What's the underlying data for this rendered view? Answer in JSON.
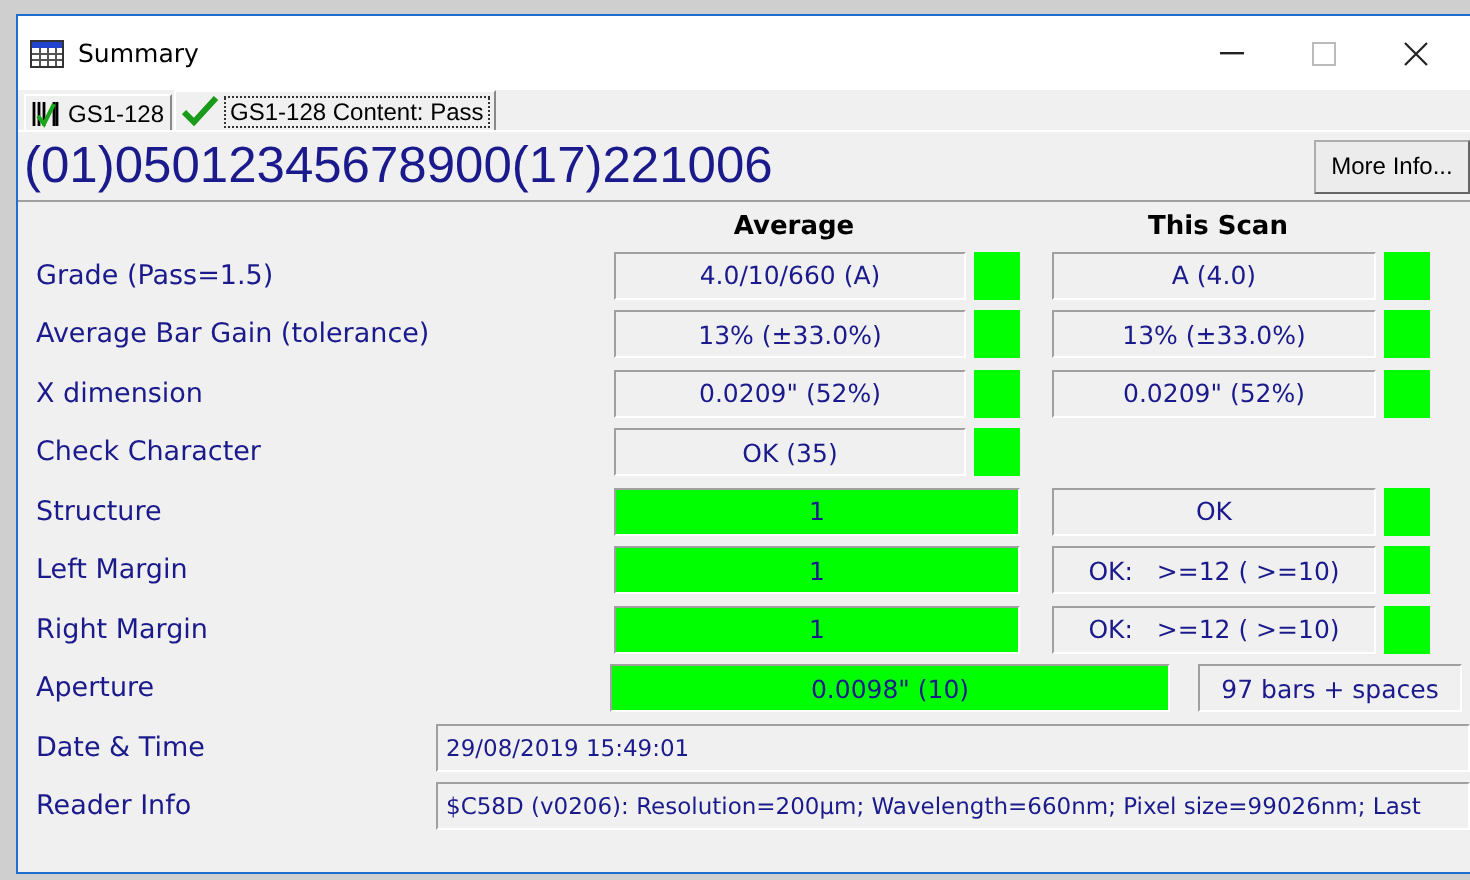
{
  "window": {
    "title": "Summary"
  },
  "tabs": [
    {
      "label": "GS1-128",
      "kind": "barcode",
      "selected": false
    },
    {
      "label": "GS1-128 Content: Pass",
      "kind": "check",
      "selected": true
    }
  ],
  "barcode_data": "(01)05012345678900(17)221006",
  "more_info_button": "More Info...",
  "columns": [
    "Average",
    "This Scan"
  ],
  "rows": [
    {
      "kind": "graded",
      "label": "Grade (Pass=1.5)",
      "average": {
        "text": "4.0/10/660 (A)",
        "pass": true
      },
      "scan": {
        "text": "A (4.0)",
        "pass": true
      }
    },
    {
      "kind": "graded",
      "label": "Average Bar Gain (tolerance)",
      "average": {
        "text": "13% (±33.0%)",
        "pass": true
      },
      "scan": {
        "text": "13% (±33.0%)",
        "pass": true
      }
    },
    {
      "kind": "graded",
      "label": "X dimension",
      "average": {
        "text": "0.0209\" (52%)",
        "pass": true
      },
      "scan": {
        "text": "0.0209\" (52%)",
        "pass": true
      }
    },
    {
      "kind": "graded",
      "label": "Check Character",
      "average": {
        "text": "OK (35)",
        "pass": true
      }
    },
    {
      "kind": "filled",
      "label": "Structure",
      "average": {
        "text": "1",
        "pass": true
      },
      "scan": {
        "text": "OK",
        "pass": true
      }
    },
    {
      "kind": "filled",
      "label": "Left Margin",
      "average": {
        "text": "1",
        "pass": true
      },
      "scan": {
        "text": "OK:   >=12 ( >=10)",
        "pass": true
      }
    },
    {
      "kind": "filled",
      "label": "Right Margin",
      "average": {
        "text": "1",
        "pass": true
      },
      "scan": {
        "text": "OK:   >=12 ( >=10)",
        "pass": true
      }
    },
    {
      "kind": "aperture",
      "label": "Aperture",
      "average": {
        "text": "0.0098\" (10)",
        "pass": true
      },
      "note": "97 bars + spaces"
    },
    {
      "kind": "info",
      "label": "Date & Time",
      "value": "29/08/2019 15:49:01"
    },
    {
      "kind": "info",
      "label": "Reader Info",
      "value": "$C58D (v0206): Resolution=200µm; Wavelength=660nm; Pixel size=99026nm; Last"
    }
  ]
}
